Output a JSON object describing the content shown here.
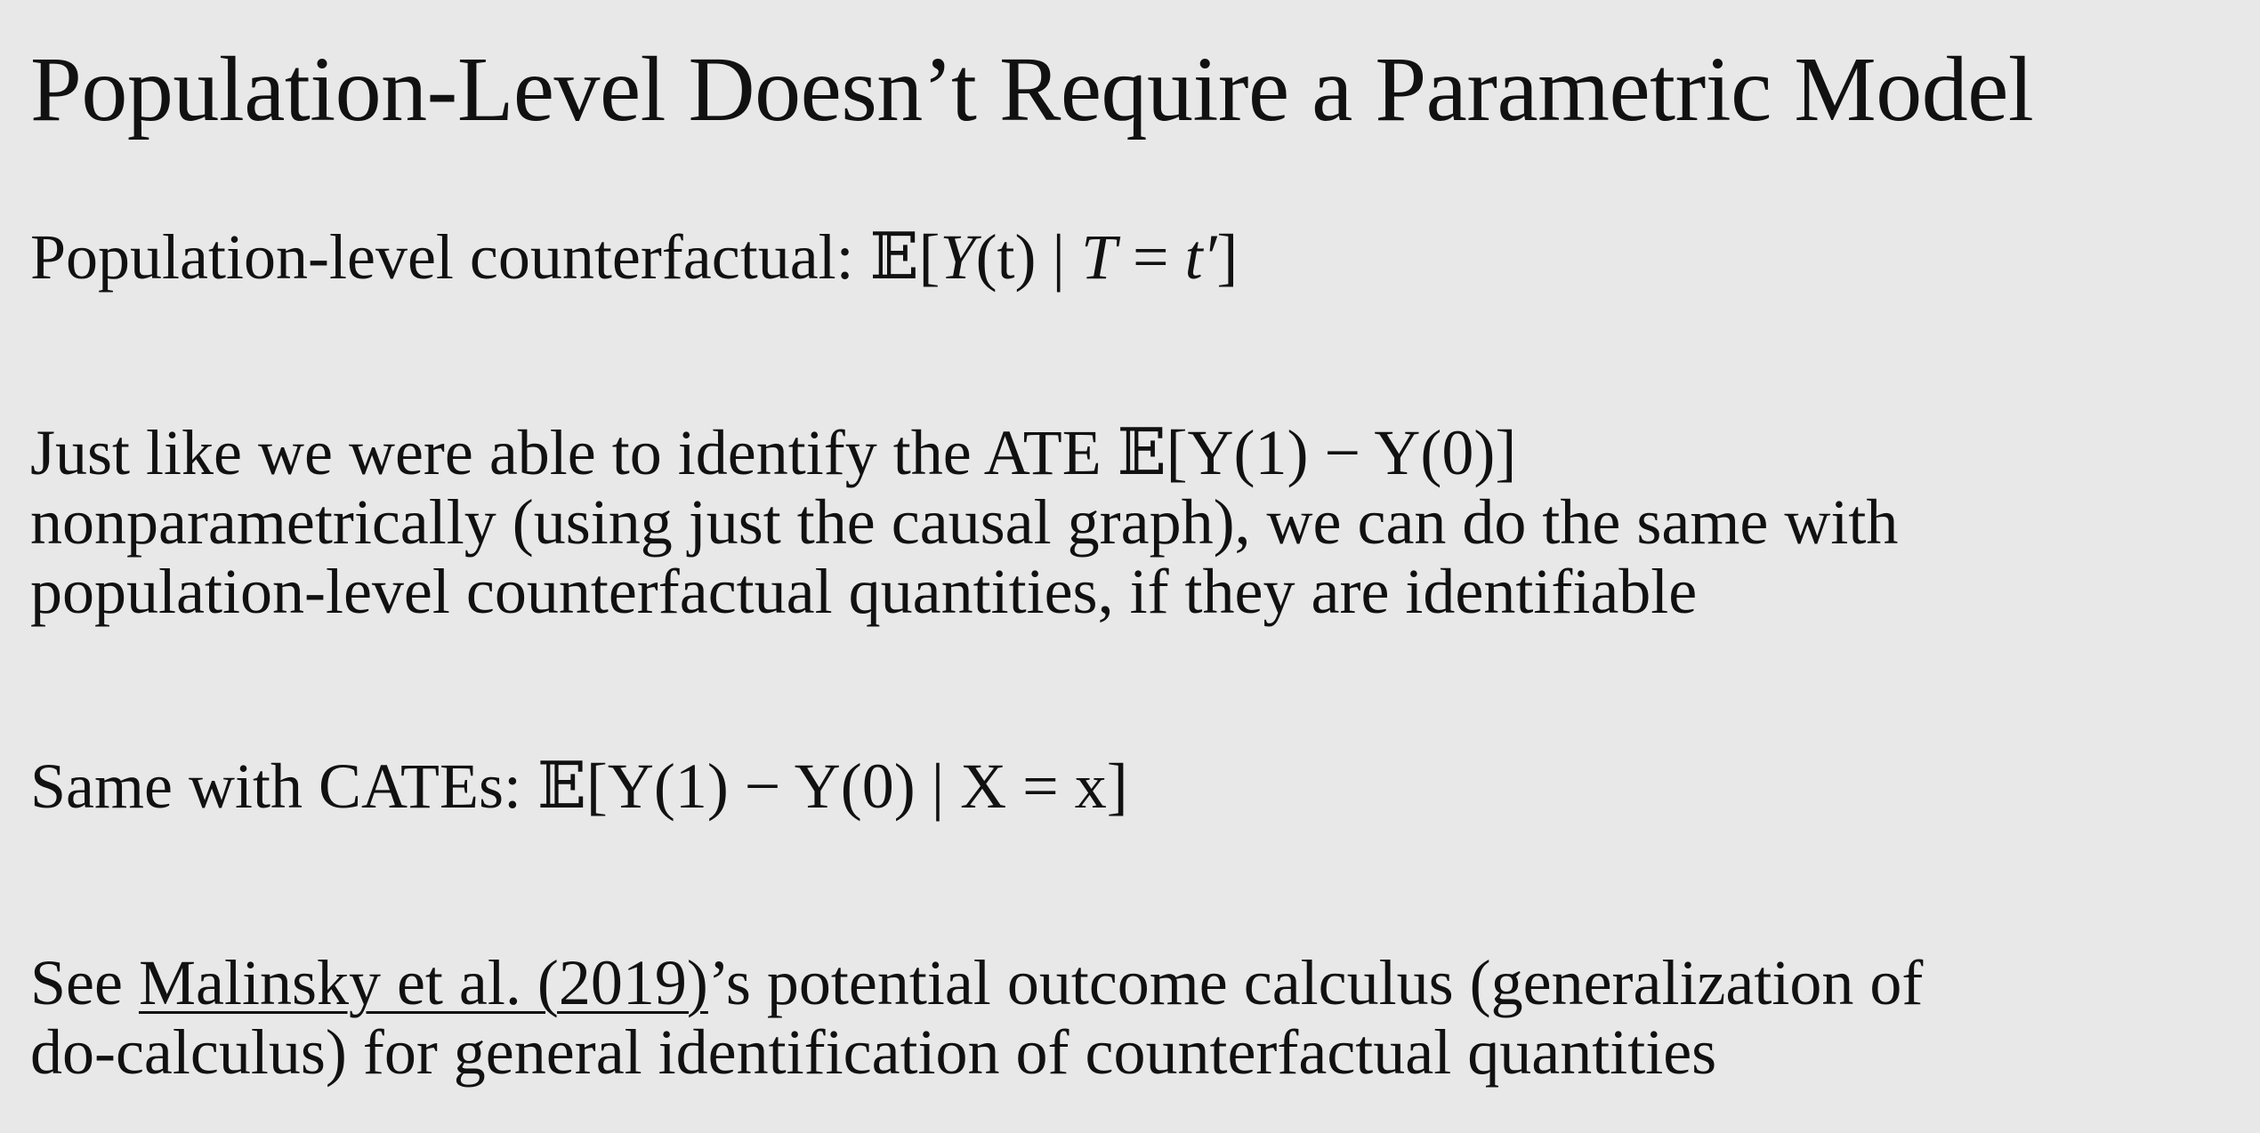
{
  "slide": {
    "title": "Population-Level Doesn’t Require a Parametric Model",
    "p1": {
      "text": "Population-level counterfactual:",
      "math": {
        "open": "𝔼[",
        "y": "Y",
        "arg": "(t) | ",
        "t": "T",
        "eq": " = ",
        "tprime": "t′",
        "close": "]"
      }
    },
    "p2": {
      "line1_text": "Just like we were able to identify the ATE",
      "line1_math": "𝔼[Y(1) − Y(0)]",
      "line2": "nonparametrically (using just the causal graph), we can do the same with",
      "line3": "population-level counterfactual quantities, if  they are identifiable"
    },
    "p3": {
      "text": "Same with CATEs:",
      "math": "𝔼[Y(1) − Y(0) | X = x]"
    },
    "p4": {
      "prefix": "See ",
      "link": "Malinsky et al. (2019)",
      "line1_rest": "’s potential outcome calculus (generalization of",
      "line2": "do-calculus) for general identification of  counterfactual quantities"
    }
  }
}
